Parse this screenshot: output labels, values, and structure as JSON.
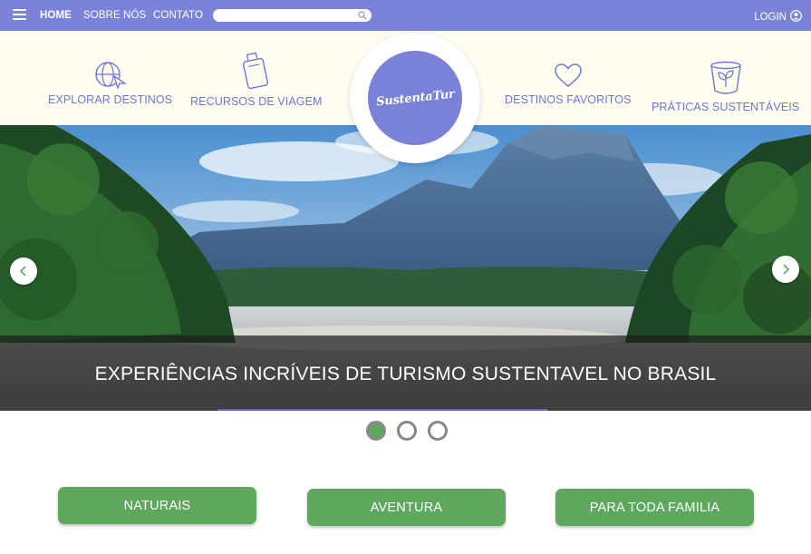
{
  "nav": {
    "home": "HOME",
    "about": "SOBRE NÓS",
    "contact": "CONTATO",
    "search_placeholder": "",
    "login": "LOGIN"
  },
  "categories": [
    {
      "label": "EXPLORAR DESTINOS",
      "icon": "globe-icon"
    },
    {
      "label": "RECURSOS DE VIAGEM",
      "icon": "luggage-icon"
    },
    {
      "label": "DESTINOS FAVORITOS",
      "icon": "heart-icon"
    },
    {
      "label": "PRÁTICAS SUSTENTÁVEIS",
      "icon": "plant-pot-icon"
    }
  ],
  "logo": {
    "text": "SustentaTur"
  },
  "hero": {
    "caption": "EXPERIÊNCIAS INCRÍVEIS DE TURISMO SUSTENTAVEL NO BRASIL",
    "slides_total": 3,
    "active_slide": 1
  },
  "buttons": [
    {
      "label": "NATURAIS"
    },
    {
      "label": "AVENTURA"
    },
    {
      "label": "PARA TODA FAMILIA"
    }
  ],
  "colors": {
    "primary": "#7b83d8",
    "accent_green": "#5da85d",
    "strip_bg": "#fffcf0"
  }
}
